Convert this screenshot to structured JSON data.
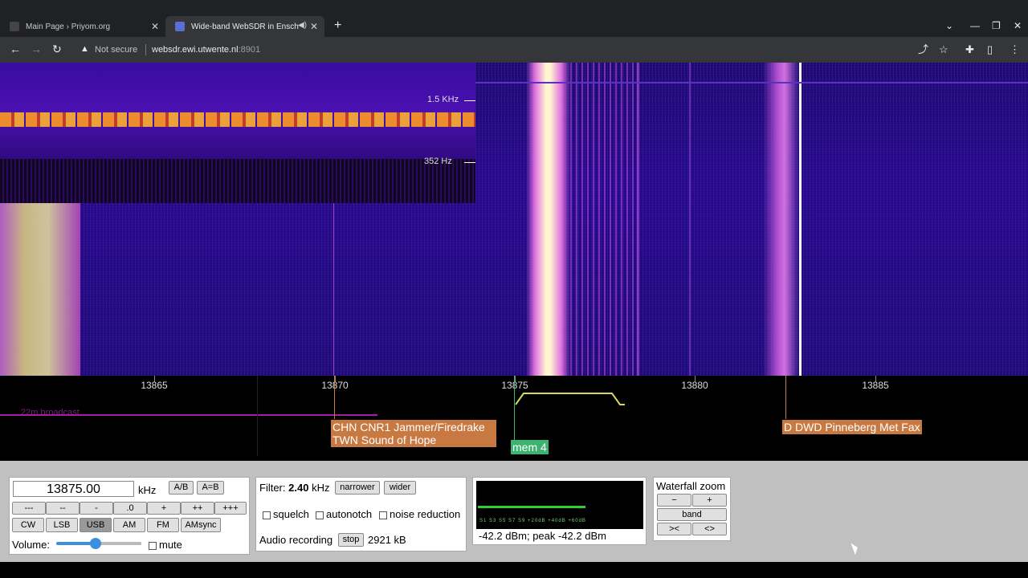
{
  "browser": {
    "tabs": [
      {
        "title": "Main Page › Priyom.org",
        "active": false
      },
      {
        "title": "Wide-band WebSDR in Ensch",
        "active": true
      }
    ],
    "security_label": "Not secure",
    "url_host": "websdr.ewi.utwente.nl",
    "url_port": ":8901"
  },
  "waterfall": {
    "inset_labels": [
      "1.5 KHz",
      "352 Hz"
    ]
  },
  "scale": {
    "frequencies": [
      "13865",
      "13870",
      "13875",
      "13880",
      "13885"
    ],
    "band_label": "22m broadcast",
    "stations": [
      {
        "line1": "CHN CNR1 Jammer/Firedrake",
        "line2": "TWN Sound of Hope"
      },
      {
        "line1": "D DWD Pinneberg Met Fax"
      }
    ],
    "memory_label": "mem 4"
  },
  "controls": {
    "frequency_value": "13875.00",
    "frequency_unit": "kHz",
    "ab_button": "A/B",
    "aeqb_button": "A=B",
    "step_buttons": [
      "---",
      "--",
      "-",
      ".0",
      "+",
      "++",
      "+++"
    ],
    "modes": [
      "CW",
      "LSB",
      "USB",
      "AM",
      "FM",
      "AMsync"
    ],
    "active_mode": "USB",
    "volume_label": "Volume:",
    "volume_level": 0.45,
    "mute_label": "mute"
  },
  "filter": {
    "label": "Filter:",
    "value": "2.40",
    "unit": "kHz",
    "narrower": "narrower",
    "wider": "wider",
    "squelch": "squelch",
    "autonotch": "autonotch",
    "noise_reduction": "noise reduction",
    "recording_label": "Audio recording",
    "stop": "stop",
    "recording_size": "2921 kB"
  },
  "smeter": {
    "scale": "S1  S3  S5  S7  S9  +20dB  +40dB  +60dB",
    "readout": "-42.2 dBm; peak  -42.2 dBm"
  },
  "zoom": {
    "title": "Waterfall zoom",
    "minus": "−",
    "plus": "+",
    "band": "band",
    "narrow": "><",
    "wide": "<>"
  }
}
